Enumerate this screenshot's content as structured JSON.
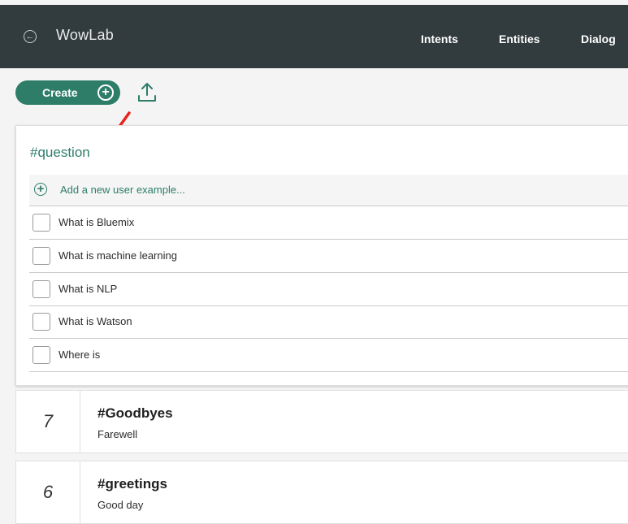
{
  "header": {
    "app_title": "WowLab",
    "back_icon": "circle-arrow-left-icon",
    "tabs": [
      {
        "label": "Intents"
      },
      {
        "label": "Entities"
      },
      {
        "label": "Dialog"
      }
    ]
  },
  "toolbar": {
    "create_label": "Create",
    "create_icon": "plus-circle-icon",
    "upload_icon": "upload-icon"
  },
  "annotation": {
    "arrow_color": "#e8231b"
  },
  "expanded_intent": {
    "name": "#question",
    "add_example_label": "Add a new user example...",
    "examples": [
      {
        "text": "What is Bluemix"
      },
      {
        "text": "What is machine learning"
      },
      {
        "text": "What is NLP"
      },
      {
        "text": "What is Watson"
      },
      {
        "text": "Where is"
      }
    ]
  },
  "intents": [
    {
      "count": "7",
      "name": "#Goodbyes",
      "description": "Farewell"
    },
    {
      "count": "6",
      "name": "#greetings",
      "description": "Good day"
    }
  ],
  "colors": {
    "header_bg": "#323b3d",
    "accent": "#2d7d69",
    "page_bg": "#f4f4f4"
  }
}
